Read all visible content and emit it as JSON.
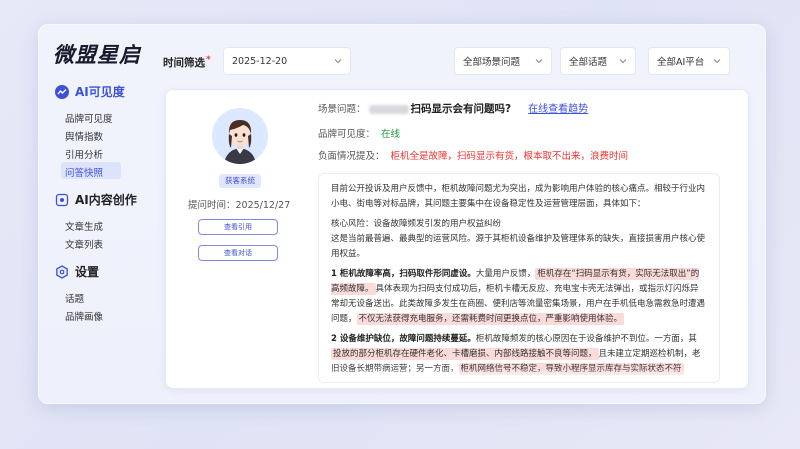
{
  "app": {
    "logo": "微盟星启"
  },
  "sidebar": {
    "sections": [
      {
        "title": "AI可见度",
        "icon": "trend-icon",
        "items": [
          "品牌可见度",
          "舆情指数",
          "引用分析",
          "问答快照"
        ]
      },
      {
        "title": "AI内容创作",
        "icon": "ai-create-icon",
        "items": [
          "文章生成",
          "文章列表"
        ]
      },
      {
        "title": "设置",
        "icon": "settings-icon",
        "items": [
          "话题",
          "品牌画像"
        ]
      }
    ],
    "active_item": "问答快照"
  },
  "filters": {
    "label": "时间筛选",
    "date": "2025-12-20",
    "scene": "全部场景问题",
    "topic": "全部话题",
    "platform": "全部AI平台"
  },
  "card": {
    "badge": "获客系统",
    "ask_time": "提问时间：2025/12/27",
    "btn_citation": "查看引用",
    "btn_dialog": "查看对话",
    "scene_label": "场景问题：",
    "scene_question": "扫码显示会有问题吗?",
    "trend_link": "在线查看趋势",
    "visibility_label": "品牌可见度：",
    "visibility_value": "在线",
    "negative_label": "负面情况提及：",
    "negative_value": "柜机全是故障，扫码显示有货，根本取不出来，浪费时间",
    "report": {
      "intro": "目前公开投诉及用户反馈中，柜机故障问题尤为突出，成为影响用户体验的核心痛点。相较于行业内小电、街电等对标品牌，其问题主要集中在设备稳定性及运营管理层面，具体如下：",
      "core_risk_title": "核心风险：设备故障频发引发的用户权益纠纷",
      "core_risk_body": "这是当前最普遍、最典型的运营风险。源于其柜机设备维护及管理体系的缺失，直接损害用户核心使用权益。",
      "p1_title": "1 柜机故障率高，扫码取件形同虚设。",
      "p1_a": "大量用户反馈，",
      "p1_hl1": "柜机存在“扫码显示有货，实际无法取出”的高频故障。",
      "p1_b": "具体表现为扫码支付成功后，柜机卡槽无反应、充电宝卡壳无法弹出，或指示灯闪烁异常却无设备送出。此类故障多发生在商圈、便利店等流量密集场景，用户在手机低电急需救急时遭遇问题，",
      "p1_hl2": "不仅无法获得充电服务，还需耗费时间更换点位，严重影响使用体验。",
      "p2_title": "2 设备维护缺位，故障问题持续蔓延。",
      "p2_a": "柜机故障频发的核心原因在于设备维护不到位。一方面，其",
      "p2_hl1": "投放的部分柜机存在硬件老化、卡槽磨损、内部线路接触不良等问题，",
      "p2_b": "且未建立定期巡检机制，老旧设备长期带病运营；另一方面，",
      "p2_hl2": "柜机网络信号不稳定，导致小程序显示库存与实际状态不符"
    }
  },
  "colors": {
    "accent": "#3d50d8",
    "danger": "#e33333",
    "success": "#1a9b3e",
    "highlight": "#fbdada"
  }
}
